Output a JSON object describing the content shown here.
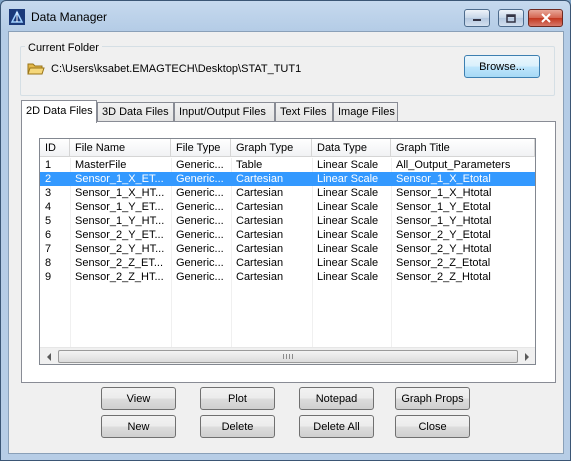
{
  "window": {
    "title": "Data Manager"
  },
  "folder": {
    "group_label": "Current Folder",
    "path": "C:\\Users\\ksabet.EMAGTECH\\Desktop\\STAT_TUT1",
    "browse_label": "Browse..."
  },
  "tabs": [
    {
      "label": "2D Data Files",
      "active": true
    },
    {
      "label": "3D Data Files",
      "active": false
    },
    {
      "label": "Input/Output Files",
      "active": false
    },
    {
      "label": "Text Files",
      "active": false
    },
    {
      "label": "Image Files",
      "active": false
    }
  ],
  "table": {
    "columns": [
      "ID",
      "File Name",
      "File Type",
      "Graph Type",
      "Data Type",
      "Graph Title"
    ],
    "selected_row": 1,
    "rows": [
      [
        "1",
        "MasterFile",
        "Generic...",
        "Table",
        "Linear Scale",
        "All_Output_Parameters"
      ],
      [
        "2",
        "Sensor_1_X_ET...",
        "Generic...",
        "Cartesian",
        "Linear Scale",
        "Sensor_1_X_Etotal"
      ],
      [
        "3",
        "Sensor_1_X_HT...",
        "Generic...",
        "Cartesian",
        "Linear Scale",
        "Sensor_1_X_Htotal"
      ],
      [
        "4",
        "Sensor_1_Y_ET...",
        "Generic...",
        "Cartesian",
        "Linear Scale",
        "Sensor_1_Y_Etotal"
      ],
      [
        "5",
        "Sensor_1_Y_HT...",
        "Generic...",
        "Cartesian",
        "Linear Scale",
        "Sensor_1_Y_Htotal"
      ],
      [
        "6",
        "Sensor_2_Y_ET...",
        "Generic...",
        "Cartesian",
        "Linear Scale",
        "Sensor_2_Y_Etotal"
      ],
      [
        "7",
        "Sensor_2_Y_HT...",
        "Generic...",
        "Cartesian",
        "Linear Scale",
        "Sensor_2_Y_Htotal"
      ],
      [
        "8",
        "Sensor_2_Z_ET...",
        "Generic...",
        "Cartesian",
        "Linear Scale",
        "Sensor_2_Z_Etotal"
      ],
      [
        "9",
        "Sensor_2_Z_HT...",
        "Generic...",
        "Cartesian",
        "Linear Scale",
        "Sensor_2_Z_Htotal"
      ]
    ]
  },
  "buttons": {
    "view": "View",
    "plot": "Plot",
    "notepad": "Notepad",
    "graph_props": "Graph Props",
    "new": "New",
    "delete": "Delete",
    "delete_all": "Delete All",
    "close": "Close"
  },
  "icons": {
    "app": "app-icon",
    "folder": "folder-icon",
    "minimize": "minimize-icon",
    "maximize": "maximize-icon",
    "close": "close-icon",
    "scroll_left": "arrow-left-icon",
    "scroll_right": "arrow-right-icon"
  },
  "colors": {
    "selection": "#3399ff",
    "close_button": "#c2361e"
  }
}
